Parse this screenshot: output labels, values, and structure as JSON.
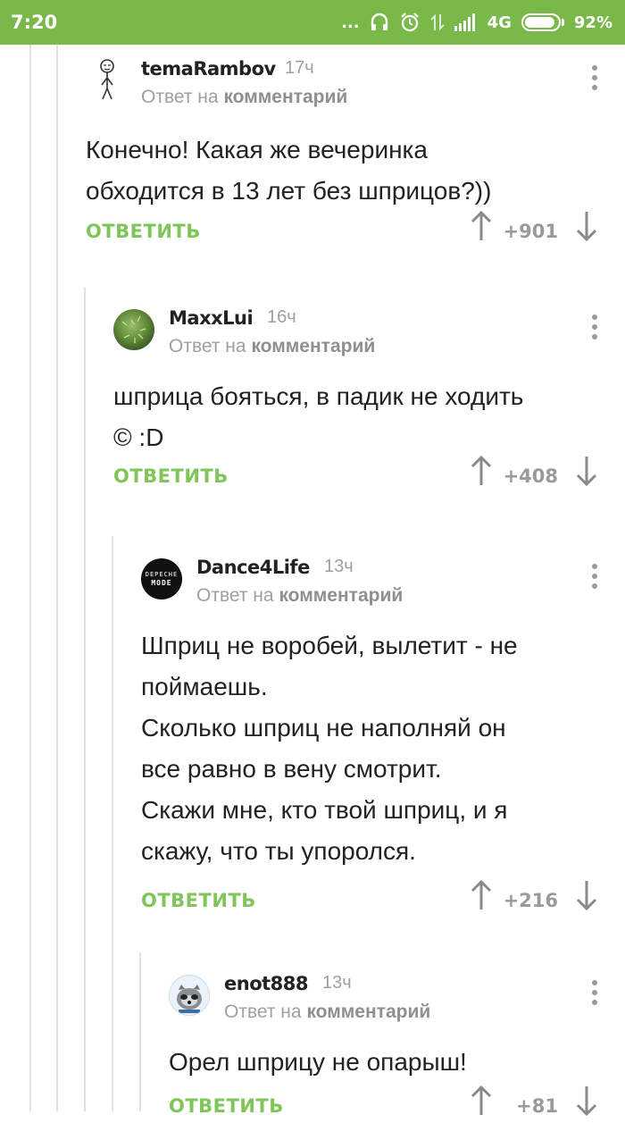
{
  "status_bar": {
    "time": "7:20",
    "dots": "...",
    "network": "4G",
    "battery": "92%",
    "battery_level": 0.92,
    "icons": [
      "headphones-icon",
      "alarm-icon",
      "data-transfer-icon",
      "signal-icon",
      "battery-icon"
    ]
  },
  "colors": {
    "accent": "#79b94a",
    "reply": "#7fc55a",
    "muted": "#a0a0a0"
  },
  "comments": [
    {
      "author": "temaRambov",
      "time": "17ч",
      "reply_prefix": "Ответ на",
      "reply_target": "комментарий",
      "lines": [
        "Конечно! Какая же вечеринка",
        "обходится в 13 лет без шприцов?))"
      ],
      "reply_label": "ОТВЕТИТЬ",
      "rating": "+901"
    },
    {
      "author": "MaxxLui",
      "time": "16ч",
      "reply_prefix": "Ответ на",
      "reply_target": "комментарий",
      "lines": [
        "шприца бояться, в падик не ходить",
        "© :D"
      ],
      "reply_label": "ОТВЕТИТЬ",
      "rating": "+408"
    },
    {
      "author": "Dance4Life",
      "time": "13ч",
      "reply_prefix": "Ответ на",
      "reply_target": "комментарий",
      "avatar_text": [
        "DEPECHE",
        "MODE"
      ],
      "lines": [
        "Шприц не воробей, вылетит - не",
        "поймаешь.",
        "Сколько шприц не наполняй он",
        "все равно в вену смотрит.",
        "Скажи мне, кто твой шприц, и я",
        "скажу, что ты упоролся."
      ],
      "reply_label": "ОТВЕТИТЬ",
      "rating": "+216"
    },
    {
      "author": "enot888",
      "time": "13ч",
      "reply_prefix": "Ответ на",
      "reply_target": "комментарий",
      "lines": [
        "Орел шприцу не опарыш!"
      ],
      "reply_label": "ОТВЕТИТЬ",
      "rating": "+81"
    }
  ]
}
